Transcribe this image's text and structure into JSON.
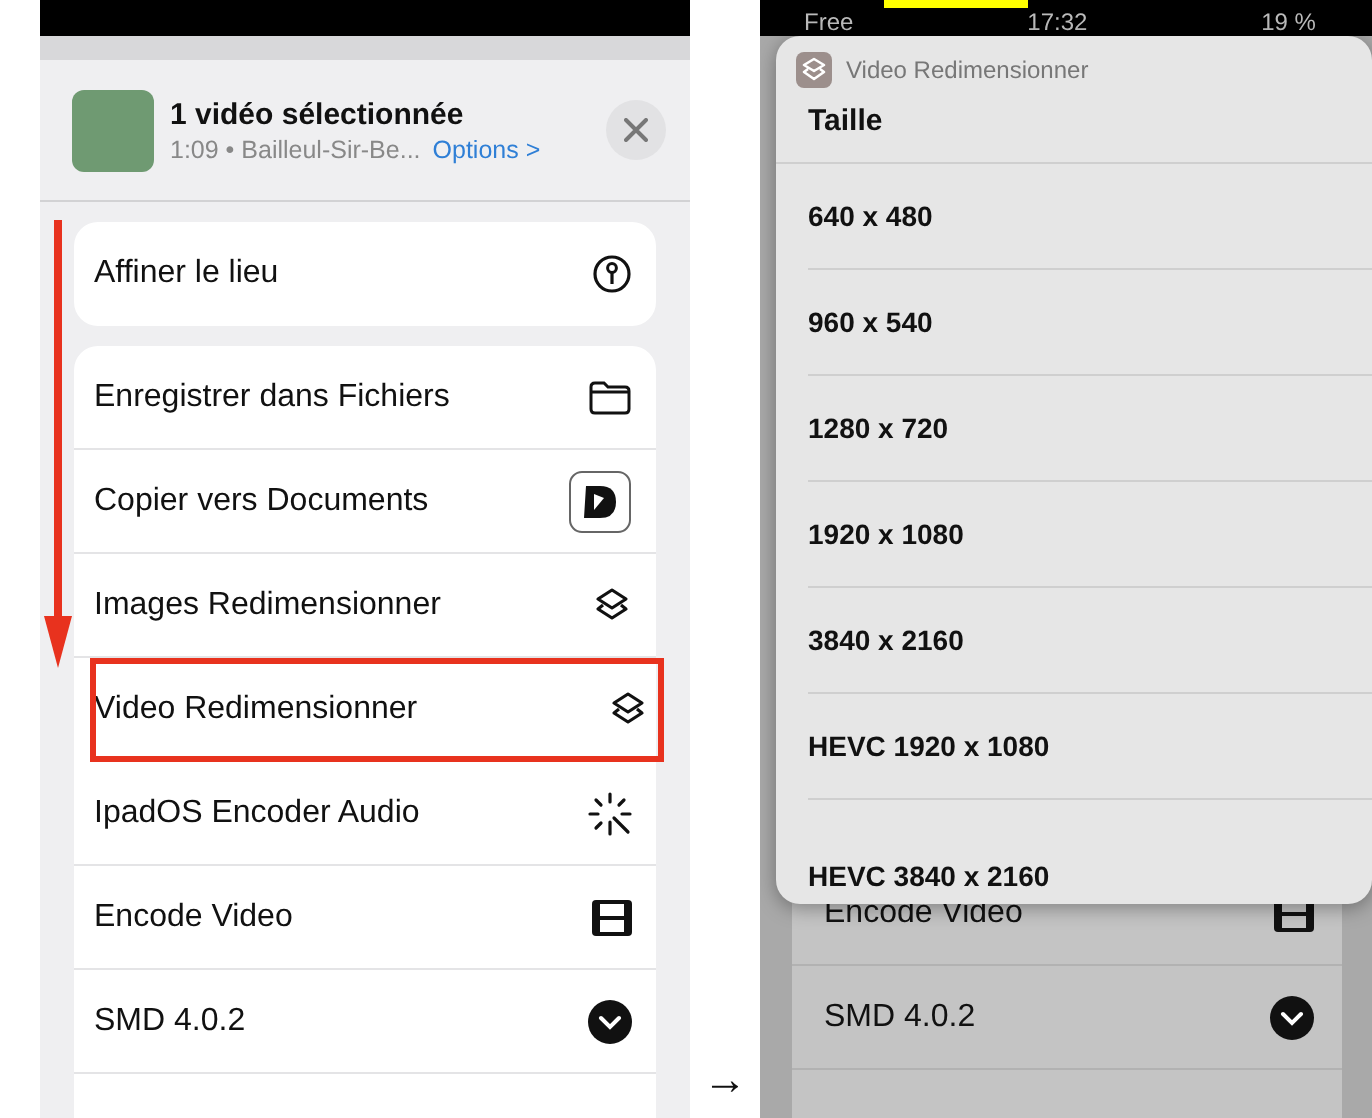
{
  "left_screen": {
    "share_sheet": {
      "title": "1 vidéo sélectionnée",
      "subtitle": "1:09 • Bailleul-Sir-Be...",
      "options_link": "Options >"
    },
    "groups": [
      [
        {
          "label": "Affiner le lieu",
          "highlighted": false
        }
      ],
      [
        {
          "label": "Enregistrer dans Fichiers",
          "highlighted": false
        },
        {
          "label": "Copier vers Documents",
          "highlighted": false
        },
        {
          "label": "Images Redimensionner",
          "highlighted": false
        },
        {
          "label": "Video Redimensionner",
          "highlighted": true
        },
        {
          "label": "IpadOS Encoder Audio",
          "highlighted": false
        },
        {
          "label": "Encode Video",
          "highlighted": false
        },
        {
          "label": "SMD 4.0.2",
          "highlighted": false
        }
      ]
    ]
  },
  "transition_arrow": "→",
  "right_screen": {
    "status_bar": {
      "carrier": "Free",
      "time": "17:32",
      "battery": "19 %"
    },
    "menu": {
      "app_name": "Video Redimensionner",
      "title": "Taille",
      "options": [
        "640 x 480",
        "960 x 540",
        "1280 x 720",
        "1920 x 1080",
        "3840 x 2160",
        "HEVC 1920 x 1080",
        "HEVC 3840 x 2160"
      ]
    },
    "background_rows": [
      "Encode Video",
      "SMD 4.0.2"
    ]
  }
}
